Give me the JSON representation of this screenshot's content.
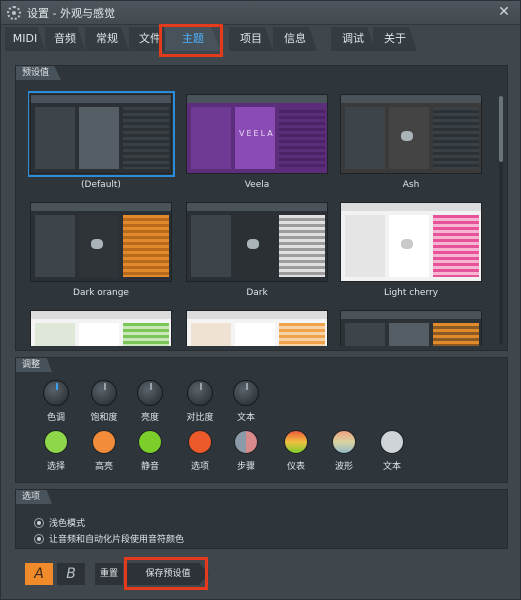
{
  "window": {
    "title": "设置 - 外观与感觉",
    "icon": "gear-icon"
  },
  "tabs": [
    {
      "label": "MIDI"
    },
    {
      "label": "音频"
    },
    {
      "label": "常规"
    },
    {
      "label": "文件"
    },
    {
      "label": "主题",
      "active": true
    },
    {
      "label": "项目"
    },
    {
      "label": "信息"
    },
    {
      "label": "调试"
    },
    {
      "label": "关于"
    }
  ],
  "presets": {
    "label": "预设值",
    "items": [
      {
        "name": "(Default)",
        "selected": true
      },
      {
        "name": "Veela",
        "wordmark": "VEELA"
      },
      {
        "name": "Ash"
      },
      {
        "name": "Dark orange"
      },
      {
        "name": "Dark"
      },
      {
        "name": "Light cherry"
      }
    ]
  },
  "adjust": {
    "label": "调整",
    "knobs": [
      {
        "label": "色调"
      },
      {
        "label": "饱和度"
      },
      {
        "label": "亮度"
      },
      {
        "label": "对比度"
      },
      {
        "label": "文本"
      }
    ],
    "colors": [
      {
        "label": "选择",
        "color": "#8ed64a"
      },
      {
        "label": "高亮",
        "color": "#f28c3a"
      },
      {
        "label": "静音",
        "color": "#7ccf2a"
      },
      {
        "label": "选项",
        "color": "#ec5a2c"
      },
      {
        "label": "步骤",
        "color": "#b9a6ad"
      },
      {
        "label": "仪表",
        "color": "#f0a84a"
      },
      {
        "label": "波形",
        "color": "#d9c8a0"
      },
      {
        "label": "文本",
        "color": "#cfd4d8"
      }
    ]
  },
  "options": {
    "label": "选项",
    "items": [
      {
        "label": "浅色模式"
      },
      {
        "label": "让音频和自动化片段使用音符颜色"
      }
    ]
  },
  "bottom": {
    "a_label": "A",
    "b_label": "B",
    "reset_label": "重置",
    "save_label": "保存预设值"
  }
}
